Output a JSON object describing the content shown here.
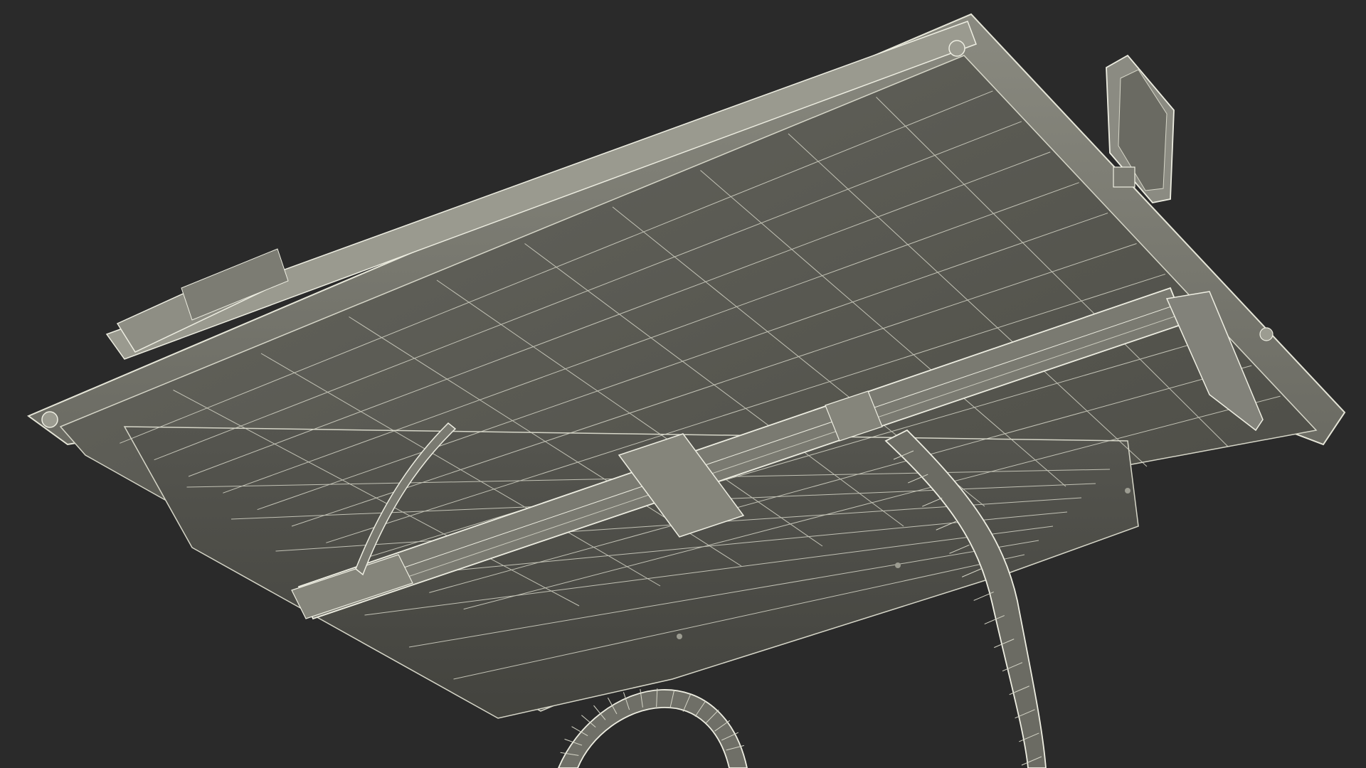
{
  "colors": {
    "background": "#2a2a2a",
    "surface": "#5b5b54",
    "surface_light": "#75756c",
    "surface_dark": "#45453f",
    "wire": "#d6d6c8",
    "wire_bright": "#eeeee2"
  }
}
